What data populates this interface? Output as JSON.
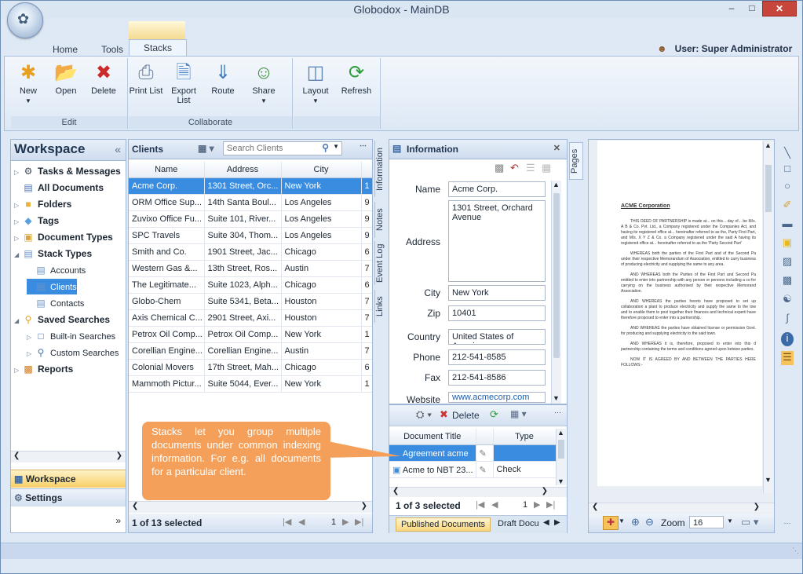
{
  "window": {
    "title": "Globodox - MainDB"
  },
  "tabs": {
    "home": "Home",
    "tools": "Tools",
    "stacks": "Stacks"
  },
  "user": {
    "label": "User: Super Administrator"
  },
  "ribbon": {
    "edit": {
      "label": "Edit",
      "new": "New",
      "open": "Open",
      "delete": "Delete"
    },
    "collaborate": {
      "label": "Collaborate",
      "print": "Print List",
      "export": "Export List",
      "route": "Route",
      "share": "Share"
    },
    "layout": "Layout",
    "refresh": "Refresh"
  },
  "workspace": {
    "title": "Workspace",
    "collapse": "«",
    "items": [
      {
        "label": "Tasks & Messages",
        "icon": "gear-icon",
        "bold": true,
        "indent": 0
      },
      {
        "label": "All Documents",
        "icon": "documents-icon",
        "bold": true,
        "indent": 0
      },
      {
        "label": "Folders",
        "icon": "folder-icon",
        "bold": true,
        "indent": 0
      },
      {
        "label": "Tags",
        "icon": "tag-icon",
        "bold": true,
        "indent": 0
      },
      {
        "label": "Document Types",
        "icon": "document-type-icon",
        "bold": true,
        "indent": 0
      },
      {
        "label": "Stack Types",
        "icon": "stack-icon",
        "bold": true,
        "indent": 0
      },
      {
        "label": "Accounts",
        "icon": "stack-icon",
        "bold": false,
        "indent": 1
      },
      {
        "label": "Clients",
        "icon": "stack-icon",
        "bold": false,
        "indent": 1
      },
      {
        "label": "Contacts",
        "icon": "stack-icon",
        "bold": false,
        "indent": 1
      },
      {
        "label": "Saved Searches",
        "icon": "saved-search-icon",
        "bold": true,
        "indent": 0
      },
      {
        "label": "Built-in Searches",
        "icon": "document-icon",
        "bold": false,
        "indent": 1
      },
      {
        "label": "Custom Searches",
        "icon": "search-icon",
        "bold": false,
        "indent": 1
      },
      {
        "label": "Reports",
        "icon": "report-icon",
        "bold": true,
        "indent": 0
      }
    ],
    "nav_workspace": "Workspace",
    "nav_settings": "Settings"
  },
  "clients": {
    "title": "Clients",
    "search_placeholder": "Search Clients",
    "columns": [
      "Name",
      "Address",
      "City"
    ],
    "rows": [
      [
        "Acme Corp.",
        "1301 Street, Orc...",
        "New York",
        "1"
      ],
      [
        "ORM Office Sup...",
        "14th Santa Boul...",
        "Los Angeles",
        "9"
      ],
      [
        "Zuvixo Office Fu...",
        "Suite 101, River...",
        "Los Angeles",
        "9"
      ],
      [
        "SPC Travels",
        "Suite 304, Thom...",
        "Los Angeles",
        "9"
      ],
      [
        "Smith and Co.",
        "1901 Street, Jac...",
        "Chicago",
        "6"
      ],
      [
        "Western Gas &...",
        "13th Street, Ros...",
        "Austin",
        "7"
      ],
      [
        "The Legitimate...",
        "Suite 1023, Alph...",
        "Chicago",
        "6"
      ],
      [
        "Globo-Chem",
        "Suite 5341, Beta...",
        "Houston",
        "7"
      ],
      [
        "Axis Chemical C...",
        "2901 Street, Axi...",
        "Houston",
        "7"
      ],
      [
        "Petrox Oil Comp...",
        "Petrox Oil Comp...",
        "New York",
        "1"
      ],
      [
        "Corellian Engine...",
        "Corellian Engine...",
        "Austin",
        "7"
      ],
      [
        "Colonial Movers",
        "17th Street, Mah...",
        "Chicago",
        "6"
      ],
      [
        "Mammoth Pictur...",
        "Suite 5044, Ever...",
        "New York",
        "1"
      ]
    ],
    "status": "1 of 13 selected",
    "pager": "1"
  },
  "side_tabs": [
    "Information",
    "Notes",
    "Event Log",
    "Links"
  ],
  "information": {
    "title": "Information",
    "fields": [
      {
        "label": "Name",
        "value": "Acme Corp."
      },
      {
        "label": "Address",
        "value": "1301 Street, Orchard Avenue"
      },
      {
        "label": "City",
        "value": "New York"
      },
      {
        "label": "Zip",
        "value": "10401"
      },
      {
        "label": "Country",
        "value": "United States of America"
      },
      {
        "label": "Phone",
        "value": "212-541-8585"
      },
      {
        "label": "Fax",
        "value": "212-541-8586"
      },
      {
        "label": "Website",
        "value": "www.acmecorp.com"
      }
    ],
    "delete_label": "Delete"
  },
  "documents": {
    "columns": [
      "Document Title",
      "Type"
    ],
    "rows": [
      [
        "Agreement acme",
        ""
      ],
      [
        "Acme to NBT 23...",
        "Check"
      ]
    ],
    "status": "1 of 3 selected",
    "pager": "1",
    "tab_published": "Published Documents",
    "tab_draft": "Draft Docu"
  },
  "pages_tab": "Pages",
  "viewer": {
    "heading": "ACME Corporation",
    "zoom_label": "Zoom",
    "zoom_value": "16",
    "paragraphs": [
      "THIS DEED OF PARTNERSHIP is made at... on this... day of... be M/s. A B & Co. Pvt. Ltd., a Company registered under the Companies Act, and having its registered office at... hereinafter referred to as the, Party First Part, and M/s. X Y Z & Co. a Company registered under the said A having its registered office at... hereinafter referred to as the 'Party Second Part'",
      "WHEREAS both the parties of the First Part and of the Second Pa under their respective Memorandum of Association, entitled to carry business of producing electricity and supplying the same to any area.",
      "AND WHEREAS both the Parties of the First Part and Second Pa entitled to enter into partnership with any person or persons including a co for carrying on the business authorised by their respective Memorand Association.",
      "AND WHEREAS the parties hereto have proposed to set up collaboration a plant to produce electricity and supply the same to the tow and to enable them to pool together their finances and technical experti have therefore proposed to enter into a partnership.",
      "AND WHEREAS the parties have obtained license or permission Govt. for producing and supplying electricity to the said town.",
      "AND WHEREAS it is, therefore, proposed to enter into this d partnership containing the terms and conditions agreed upon betwee parties.",
      "NOW IT IS AGREED BY AND BETWEEN THE PARTIES HERE FOLLOWS:-"
    ]
  },
  "tooltip": {
    "text": "Stacks let you group multiple documents under common indexing information. For e.g. all documents for a particular client."
  }
}
